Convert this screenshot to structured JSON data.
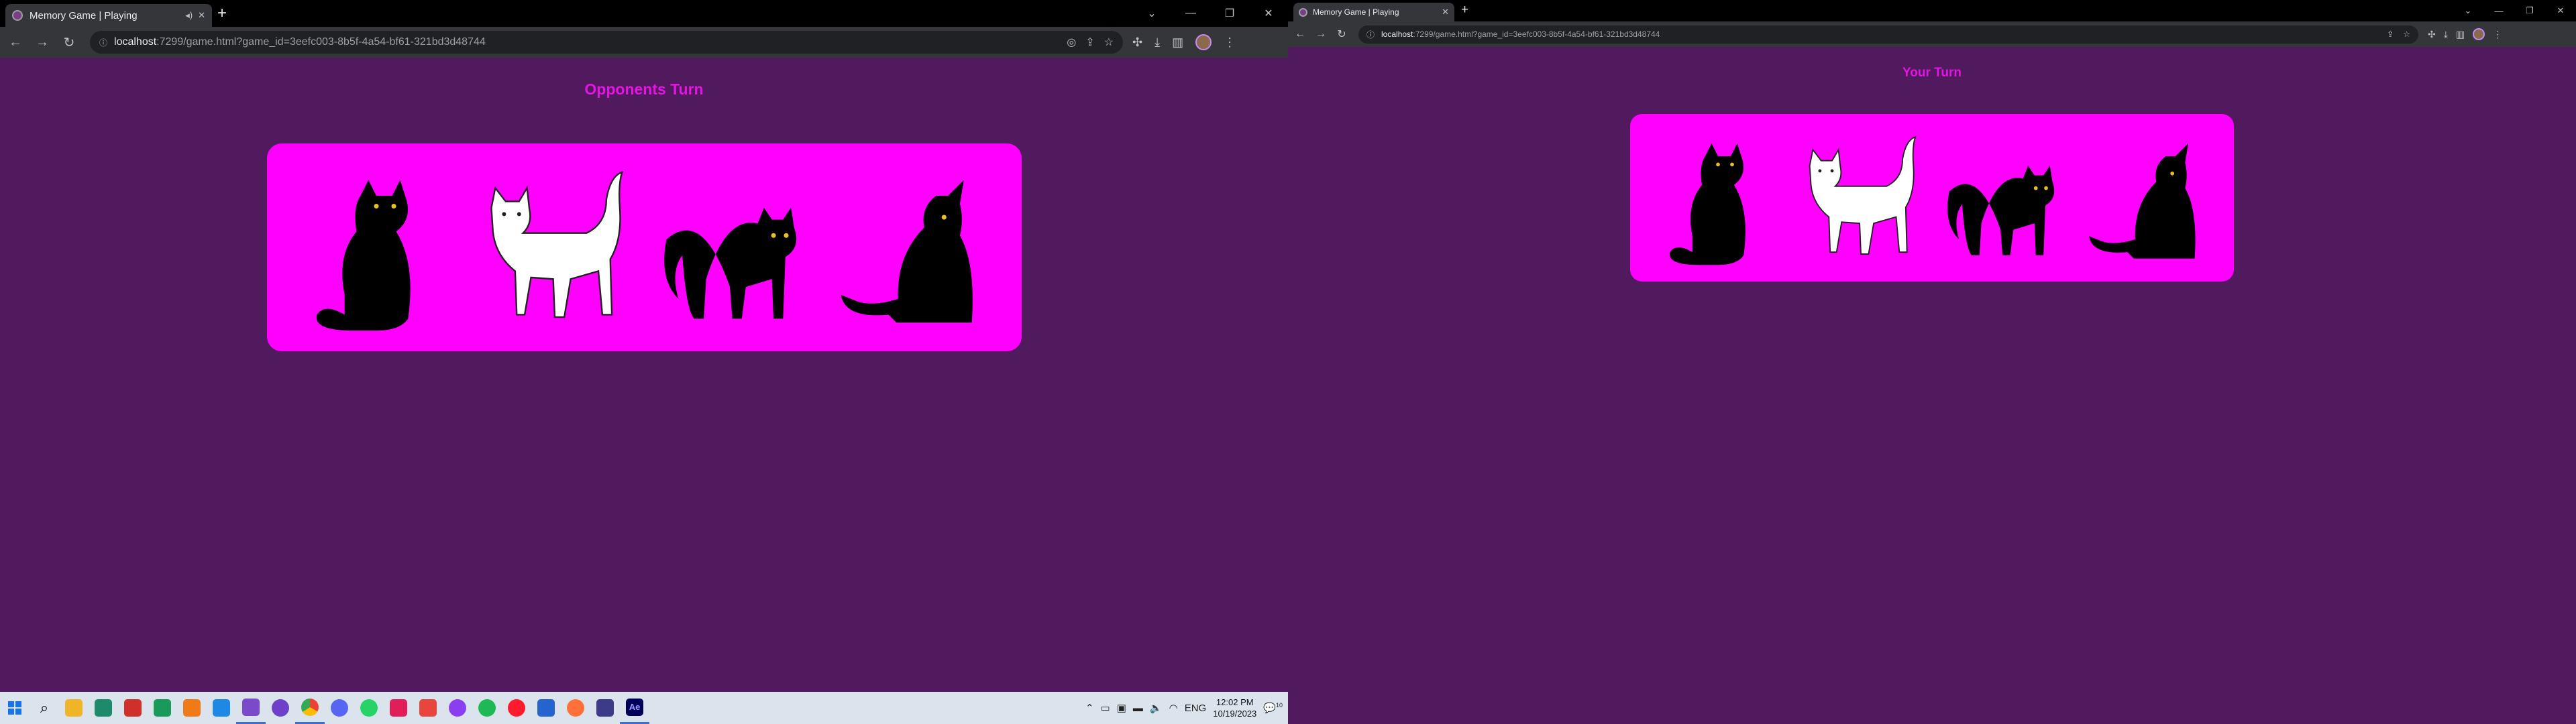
{
  "windows": [
    {
      "tab_title": "Memory Game | Playing",
      "url_host": "localhost",
      "url_rest": ":7299/game.html?game_id=3eefc003-8b5f-4a54-bf61-321bd3d48744",
      "turn_label": "Opponents Turn"
    },
    {
      "tab_title": "Memory Game | Playing",
      "url_host": "localhost",
      "url_rest": ":7299/game.html?game_id=3eefc003-8b5f-4a54-bf61-321bd3d48744",
      "turn_label": "Your Turn"
    }
  ],
  "cards": [
    "black-cat-sitting",
    "white-cat-walking",
    "black-cat-arched",
    "black-cat-sitting-back"
  ],
  "colors": {
    "page_bg": "#521a5e",
    "board_bg": "#ff00ff",
    "turn_text": "#e215e2"
  },
  "taskbar": {
    "icons": [
      "windows-start-icon",
      "search-icon",
      "file-explorer-icon",
      "app-icon",
      "app-icon",
      "pycharm-icon",
      "sublime-icon",
      "vscode-icon",
      "visual-studio-icon",
      "github-icon",
      "chrome-icon",
      "discord-icon",
      "whatsapp-icon",
      "slack-icon",
      "app-icon",
      "messenger-icon",
      "spotify-icon",
      "opera-icon",
      "todo-icon",
      "firefox-icon",
      "app-icon",
      "after-effects-icon"
    ],
    "language": "ENG",
    "time": "12:02 PM",
    "date": "10/19/2023",
    "ae_label": "Ae",
    "notif_count": "10"
  }
}
